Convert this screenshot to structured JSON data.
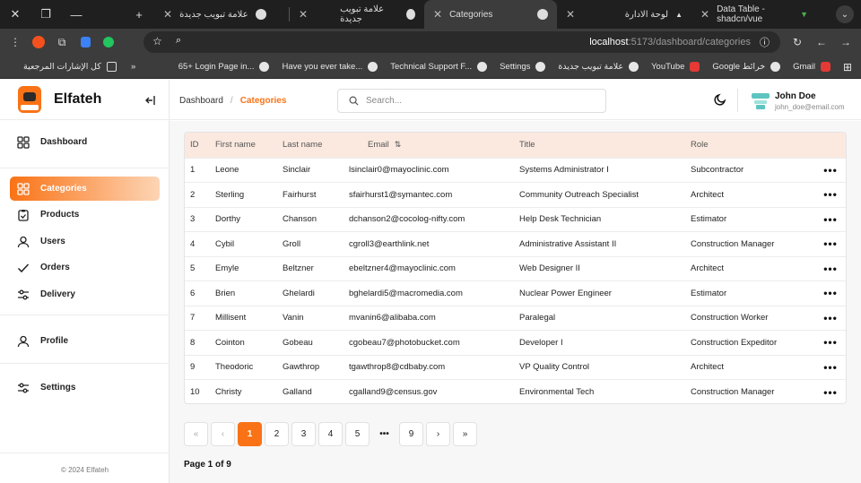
{
  "browser": {
    "tabs": [
      {
        "title": "علامة تبويب جديدة",
        "active": false
      },
      {
        "title": "علامة تبويب جديدة",
        "active": false
      },
      {
        "title": "Categories",
        "active": true
      },
      {
        "title": "لوحة الادارة",
        "active": false
      },
      {
        "title": "Data Table - shadcn/vue",
        "active": false
      }
    ],
    "url_host": "localhost",
    "url_path": ":5173/dashboard/categories",
    "bookmarks": [
      "كل الإشارات المرجعية",
      "65+ Login Page in...",
      "Have you ever take...",
      "Technical Support F...",
      "Settings",
      "علامة تبويب جديدة",
      "YouTube",
      "Google خرائط",
      "Gmail"
    ]
  },
  "app": {
    "brand": "Elfateh",
    "nav": {
      "dashboard": "Dashboard",
      "categories": "Categories",
      "products": "Products",
      "users": "Users",
      "orders": "Orders",
      "delivery": "Delivery",
      "profile": "Profile",
      "settings": "Settings"
    },
    "copyright": "© 2024 Elfateh",
    "breadcrumb": {
      "root": "Dashboard",
      "sep": "/",
      "current": "Categories"
    },
    "search_placeholder": "Search...",
    "user": {
      "name": "John Doe",
      "email": "john_doe@email.com"
    }
  },
  "table": {
    "headers": {
      "id": "ID",
      "first": "First name",
      "last": "Last name",
      "email": "Email",
      "title": "Title",
      "role": "Role"
    },
    "actions_label": "•••",
    "rows": [
      {
        "id": "1",
        "first": "Leone",
        "last": "Sinclair",
        "email": "lsinclair0@mayoclinic.com",
        "title": "Systems Administrator I",
        "role": "Subcontractor"
      },
      {
        "id": "2",
        "first": "Sterling",
        "last": "Fairhurst",
        "email": "sfairhurst1@symantec.com",
        "title": "Community Outreach Specialist",
        "role": "Architect"
      },
      {
        "id": "3",
        "first": "Dorthy",
        "last": "Chanson",
        "email": "dchanson2@cocolog-nifty.com",
        "title": "Help Desk Technician",
        "role": "Estimator"
      },
      {
        "id": "4",
        "first": "Cybil",
        "last": "Groll",
        "email": "cgroll3@earthlink.net",
        "title": "Administrative Assistant II",
        "role": "Construction Manager"
      },
      {
        "id": "5",
        "first": "Emyle",
        "last": "Beltzner",
        "email": "ebeltzner4@mayoclinic.com",
        "title": "Web Designer II",
        "role": "Architect"
      },
      {
        "id": "6",
        "first": "Brien",
        "last": "Ghelardi",
        "email": "bghelardi5@macromedia.com",
        "title": "Nuclear Power Engineer",
        "role": "Estimator"
      },
      {
        "id": "7",
        "first": "Millisent",
        "last": "Vanin",
        "email": "mvanin6@alibaba.com",
        "title": "Paralegal",
        "role": "Construction Worker"
      },
      {
        "id": "8",
        "first": "Cointon",
        "last": "Gobeau",
        "email": "cgobeau7@photobucket.com",
        "title": "Developer I",
        "role": "Construction Expeditor"
      },
      {
        "id": "9",
        "first": "Theodoric",
        "last": "Gawthrop",
        "email": "tgawthrop8@cdbaby.com",
        "title": "VP Quality Control",
        "role": "Architect"
      },
      {
        "id": "10",
        "first": "Christy",
        "last": "Galland",
        "email": "cgalland9@census.gov",
        "title": "Environmental Tech",
        "role": "Construction Manager"
      }
    ]
  },
  "pagination": {
    "first": "«",
    "prev": "‹",
    "next": "›",
    "last": "»",
    "pages": [
      "1",
      "2",
      "3",
      "4",
      "5"
    ],
    "ellipsis": "•••",
    "last_page": "9",
    "current": "1",
    "info": "Page 1 of 9"
  },
  "colors": {
    "accent": "#f97316",
    "header_row": "#fbe9df"
  }
}
